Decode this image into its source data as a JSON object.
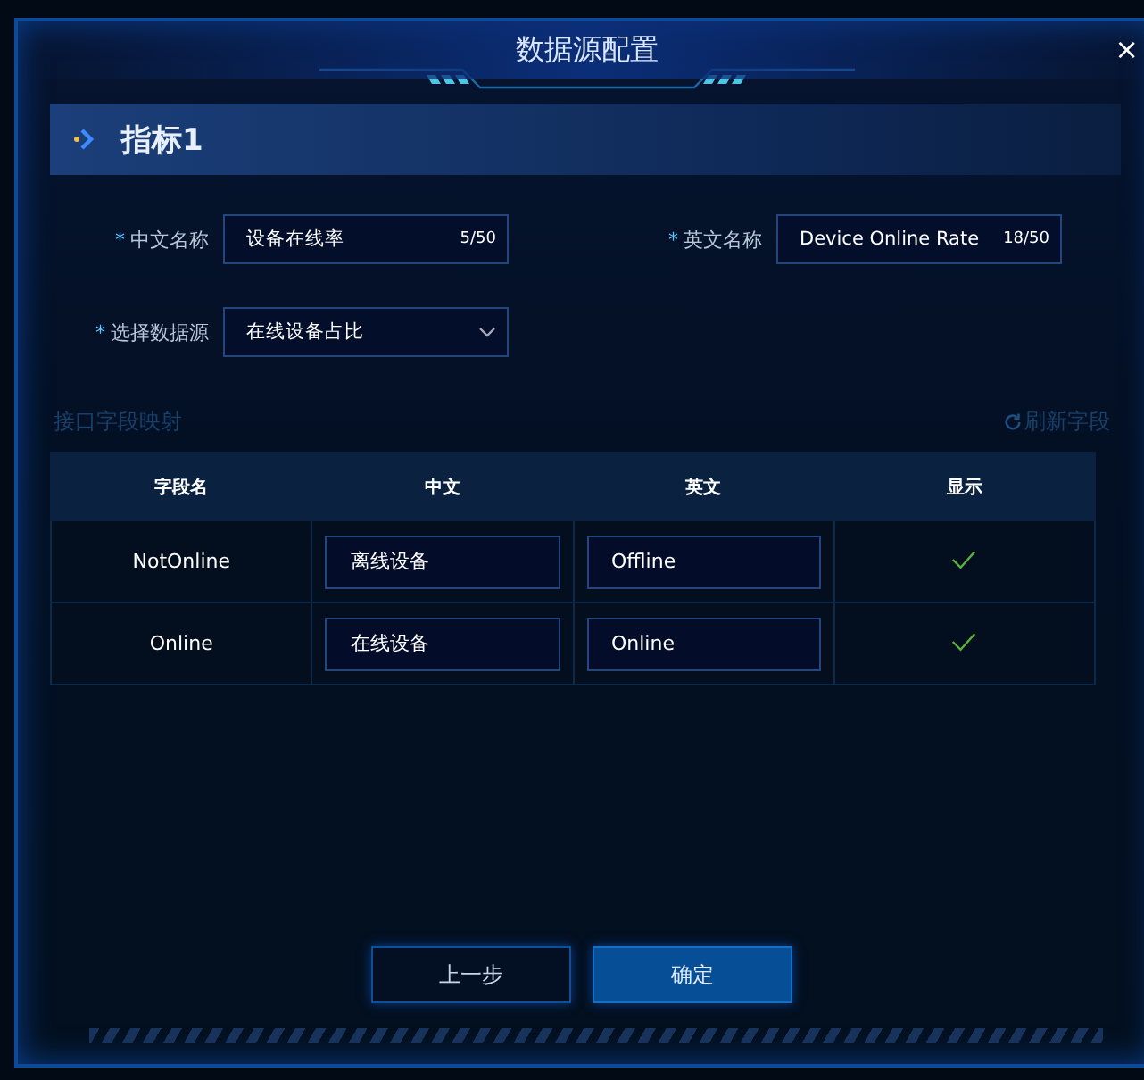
{
  "window": {
    "title": "数据源配置",
    "close": "×"
  },
  "section": {
    "title": "指标1"
  },
  "fields": [
    {
      "kind": "text",
      "mark": "*",
      "label": "中文名称",
      "value": "设备在线率",
      "counter": "5/50"
    },
    {
      "kind": "text",
      "mark": "*",
      "label": "英文名称",
      "value": "Device Online Rate",
      "counter": "18/50"
    },
    {
      "kind": "select",
      "mark": "*",
      "label": "选择数据源",
      "value": "在线设备占比"
    }
  ],
  "mapping": {
    "title": "接口字段映射",
    "refresh": "刷新字段"
  },
  "table": {
    "columns": [
      "字段名",
      "中文",
      "英文",
      "显示"
    ],
    "rows": [
      {
        "field": "NotOnline",
        "zh": "离线设备",
        "en": "Offline",
        "shown": true
      },
      {
        "field": "Online",
        "zh": "在线设备",
        "en": "Online",
        "shown": true
      }
    ]
  },
  "buttons": [
    {
      "label": "上一步",
      "kind": "default"
    },
    {
      "label": "确定",
      "kind": "primary"
    }
  ]
}
